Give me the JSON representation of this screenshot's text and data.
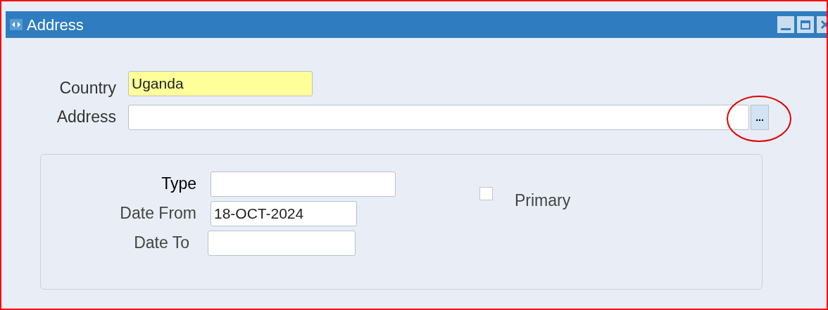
{
  "window": {
    "title": "Address"
  },
  "fields": [
    {
      "label": "Country",
      "value": "Uganda",
      "required": true
    },
    {
      "label": "Address",
      "required": false,
      "button": "..."
    }
  ],
  "panel": {
    "fields": [
      {
        "label": "Type",
        "required": false,
        "bold": true
      },
      {
        "label": "Date From",
        "value": "18-OCT-2024",
        "required": false,
        "bold": false
      },
      {
        "label": "Date To",
        "required": false,
        "bold": false
      }
    ],
    "checkbox": {
      "label": "Primary",
      "checked": false
    }
  }
}
